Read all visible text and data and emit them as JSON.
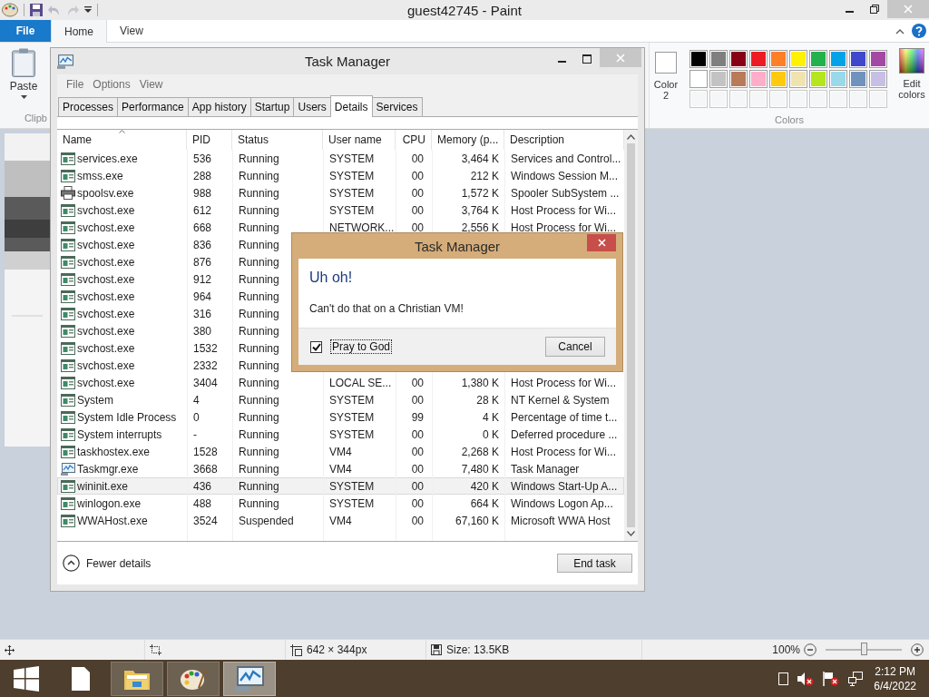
{
  "paint": {
    "title": "guest42745 - Paint",
    "ribbon_tabs": [
      {
        "label": "File",
        "kind": "file",
        "selected": false
      },
      {
        "label": "Home",
        "kind": "tab",
        "selected": true
      },
      {
        "label": "View",
        "kind": "tab",
        "selected": false
      }
    ],
    "clipboard": {
      "paste_label": "Paste",
      "group_label": "Clipb"
    },
    "colors": {
      "color2_label": "Color 2",
      "edit_label": "Edit colors",
      "group_label": "Colors",
      "swatches": [
        {
          "kind": "color",
          "color": "#000000"
        },
        {
          "kind": "color",
          "color": "#7f7f7f"
        },
        {
          "kind": "color",
          "color": "#880015"
        },
        {
          "kind": "color",
          "color": "#ed1c24"
        },
        {
          "kind": "color",
          "color": "#ff7f27"
        },
        {
          "kind": "color",
          "color": "#fff200"
        },
        {
          "kind": "color",
          "color": "#22b14c"
        },
        {
          "kind": "color",
          "color": "#00a2e8"
        },
        {
          "kind": "color",
          "color": "#3f48cc"
        },
        {
          "kind": "color",
          "color": "#a349a4"
        },
        {
          "kind": "color",
          "color": "#ffffff"
        },
        {
          "kind": "color",
          "color": "#c3c3c3"
        },
        {
          "kind": "color",
          "color": "#b97a57"
        },
        {
          "kind": "color",
          "color": "#ffaec9"
        },
        {
          "kind": "color",
          "color": "#ffc90e"
        },
        {
          "kind": "color",
          "color": "#efe4b0"
        },
        {
          "kind": "color",
          "color": "#b5e61d"
        },
        {
          "kind": "color",
          "color": "#99d9ea"
        },
        {
          "kind": "color",
          "color": "#7092be"
        },
        {
          "kind": "color",
          "color": "#c8bfe7"
        },
        {
          "kind": "empty"
        },
        {
          "kind": "empty"
        },
        {
          "kind": "empty"
        },
        {
          "kind": "empty"
        },
        {
          "kind": "empty"
        },
        {
          "kind": "empty"
        },
        {
          "kind": "empty"
        },
        {
          "kind": "empty"
        },
        {
          "kind": "empty"
        },
        {
          "kind": "empty"
        }
      ]
    },
    "status_bar": {
      "dimensions": "642 × 344px",
      "size": "Size: 13.5KB",
      "zoom": "100%",
      "zoom_slider": {
        "level": 0.5
      }
    }
  },
  "task_manager": {
    "title": "Task Manager",
    "menu": [
      "File",
      "Options",
      "View"
    ],
    "tabs": [
      {
        "label": "Processes",
        "selected": false
      },
      {
        "label": "Performance",
        "selected": false
      },
      {
        "label": "App history",
        "selected": false
      },
      {
        "label": "Startup",
        "selected": false
      },
      {
        "label": "Users",
        "selected": false
      },
      {
        "label": "Details",
        "selected": true
      },
      {
        "label": "Services",
        "selected": false
      }
    ],
    "columns": [
      {
        "label": "Name",
        "sorted": true
      },
      {
        "label": "PID",
        "sorted": false
      },
      {
        "label": "Status",
        "sorted": false
      },
      {
        "label": "User name",
        "sorted": false
      },
      {
        "label": "CPU",
        "sorted": false
      },
      {
        "label": "Memory (p...",
        "sorted": false
      },
      {
        "label": "Description",
        "sorted": false
      }
    ],
    "rows": [
      {
        "kind": "app",
        "name": "services.exe",
        "pid": "536",
        "status": "Running",
        "user": "SYSTEM",
        "cpu": "00",
        "memory": "3,464 K",
        "description": "Services and Control...",
        "selected": false
      },
      {
        "kind": "app",
        "name": "smss.exe",
        "pid": "288",
        "status": "Running",
        "user": "SYSTEM",
        "cpu": "00",
        "memory": "212 K",
        "description": "Windows Session M...",
        "selected": false
      },
      {
        "kind": "printer",
        "name": "spoolsv.exe",
        "pid": "988",
        "status": "Running",
        "user": "SYSTEM",
        "cpu": "00",
        "memory": "1,572 K",
        "description": "Spooler SubSystem ...",
        "selected": false
      },
      {
        "kind": "app",
        "name": "svchost.exe",
        "pid": "612",
        "status": "Running",
        "user": "SYSTEM",
        "cpu": "00",
        "memory": "3,764 K",
        "description": "Host Process for Wi...",
        "selected": false
      },
      {
        "kind": "app",
        "name": "svchost.exe",
        "pid": "668",
        "status": "Running",
        "user": "NETWORK...",
        "cpu": "00",
        "memory": "2,556 K",
        "description": "Host Process for Wi...",
        "selected": false
      },
      {
        "kind": "app",
        "name": "svchost.exe",
        "pid": "836",
        "status": "Running",
        "selected": false
      },
      {
        "kind": "app",
        "name": "svchost.exe",
        "pid": "876",
        "status": "Running",
        "selected": false
      },
      {
        "kind": "app",
        "name": "svchost.exe",
        "pid": "912",
        "status": "Running",
        "selected": false
      },
      {
        "kind": "app",
        "name": "svchost.exe",
        "pid": "964",
        "status": "Running",
        "selected": false
      },
      {
        "kind": "app",
        "name": "svchost.exe",
        "pid": "316",
        "status": "Running",
        "selected": false
      },
      {
        "kind": "app",
        "name": "svchost.exe",
        "pid": "380",
        "status": "Running",
        "selected": false
      },
      {
        "kind": "app",
        "name": "svchost.exe",
        "pid": "1532",
        "status": "Running",
        "selected": false
      },
      {
        "kind": "app",
        "name": "svchost.exe",
        "pid": "2332",
        "status": "Running",
        "selected": false
      },
      {
        "kind": "app",
        "name": "svchost.exe",
        "pid": "3404",
        "status": "Running",
        "user": "LOCAL SE...",
        "cpu": "00",
        "memory": "1,380 K",
        "description": "Host Process for Wi...",
        "selected": false
      },
      {
        "kind": "app",
        "name": "System",
        "pid": "4",
        "status": "Running",
        "user": "SYSTEM",
        "cpu": "00",
        "memory": "28 K",
        "description": "NT Kernel & System",
        "selected": false
      },
      {
        "kind": "app",
        "name": "System Idle Process",
        "pid": "0",
        "status": "Running",
        "user": "SYSTEM",
        "cpu": "99",
        "memory": "4 K",
        "description": "Percentage of time t...",
        "selected": false
      },
      {
        "kind": "app",
        "name": "System interrupts",
        "pid": "-",
        "status": "Running",
        "user": "SYSTEM",
        "cpu": "00",
        "memory": "0 K",
        "description": "Deferred procedure ...",
        "selected": false
      },
      {
        "kind": "app",
        "name": "taskhostex.exe",
        "pid": "1528",
        "status": "Running",
        "user": "VM4",
        "cpu": "00",
        "memory": "2,268 K",
        "description": "Host Process for Wi...",
        "selected": false
      },
      {
        "kind": "monitor",
        "name": "Taskmgr.exe",
        "pid": "3668",
        "status": "Running",
        "user": "VM4",
        "cpu": "00",
        "memory": "7,480 K",
        "description": "Task Manager",
        "selected": false
      },
      {
        "kind": "app",
        "name": "wininit.exe",
        "pid": "436",
        "status": "Running",
        "user": "SYSTEM",
        "cpu": "00",
        "memory": "420 K",
        "description": "Windows Start-Up A...",
        "selected": true
      },
      {
        "kind": "app",
        "name": "winlogon.exe",
        "pid": "488",
        "status": "Running",
        "user": "SYSTEM",
        "cpu": "00",
        "memory": "664 K",
        "description": "Windows Logon Ap...",
        "selected": false
      },
      {
        "kind": "app",
        "name": "WWAHost.exe",
        "pid": "3524",
        "status": "Suspended",
        "user": "VM4",
        "cpu": "00",
        "memory": "67,160 K",
        "description": "Microsoft WWA Host",
        "selected": false
      }
    ],
    "fewer_details": "Fewer details",
    "end_task": "End task"
  },
  "dialog": {
    "title": "Task Manager",
    "heading": "Uh oh!",
    "message": "Can't do that on a Christian VM!",
    "checkbox": {
      "label": "Pray to God",
      "checked": true
    },
    "button": "Cancel"
  },
  "taskbar": {
    "apps": [
      {
        "kind": "document",
        "running": false,
        "active": false
      },
      {
        "kind": "explorer",
        "running": true,
        "active": false
      },
      {
        "kind": "paint",
        "running": true,
        "active": false
      },
      {
        "kind": "monitor",
        "running": true,
        "active": true
      }
    ],
    "time": "2:12 PM",
    "date": "6/4/2022"
  }
}
